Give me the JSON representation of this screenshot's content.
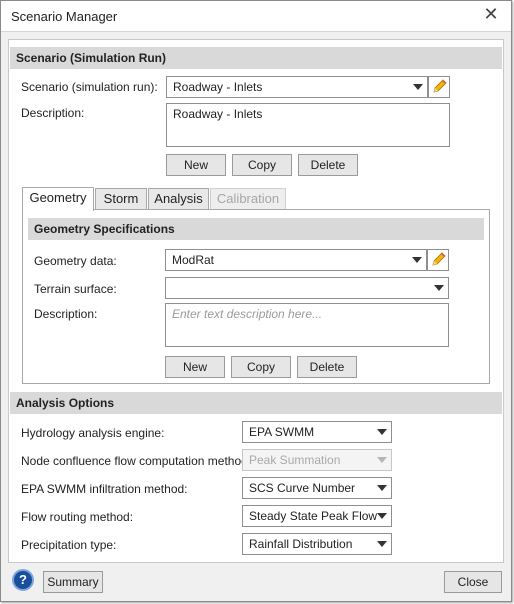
{
  "window": {
    "title": "Scenario Manager",
    "close_glyph": "✕"
  },
  "scenario": {
    "header": "Scenario (Simulation Run)",
    "scenario_label": "Scenario (simulation run):",
    "scenario_value": "Roadway - Inlets",
    "description_label": "Description:",
    "description_value": "Roadway - Inlets",
    "buttons": {
      "new": "New",
      "copy": "Copy",
      "delete": "Delete"
    }
  },
  "tabs": [
    {
      "label": "Geometry",
      "active": true
    },
    {
      "label": "Storm",
      "active": false
    },
    {
      "label": "Analysis",
      "active": false
    },
    {
      "label": "Calibration",
      "active": false,
      "disabled": true
    }
  ],
  "geometry": {
    "header": "Geometry Specifications",
    "geometry_label": "Geometry data:",
    "geometry_value": "ModRat",
    "terrain_label": "Terrain surface:",
    "terrain_value": "",
    "description_label": "Description:",
    "description_placeholder": "Enter text description here...",
    "buttons": {
      "new": "New",
      "copy": "Copy",
      "delete": "Delete"
    }
  },
  "analysis": {
    "header": "Analysis Options",
    "options": [
      {
        "label": "Hydrology analysis engine:",
        "value": "EPA SWMM",
        "disabled": false
      },
      {
        "label": "Node confluence flow computation method:",
        "value": "Peak Summation",
        "disabled": true
      },
      {
        "label": "EPA SWMM infiltration method:",
        "value": "SCS Curve Number",
        "disabled": false
      },
      {
        "label": "Flow routing method:",
        "value": "Steady State Peak Flow",
        "disabled": false
      },
      {
        "label": "Precipitation type:",
        "value": "Rainfall Distribution",
        "disabled": false
      }
    ]
  },
  "footer": {
    "help_glyph": "?",
    "summary": "Summary",
    "close": "Close"
  },
  "colors": {
    "help_button": "#1a4f9c",
    "section_header": "#d9d9d9",
    "pencil": "#f2b705"
  },
  "icons": {
    "edit": "pencil-icon",
    "help": "help-icon",
    "dropdown": "chevron-down-icon",
    "close": "close-icon"
  }
}
